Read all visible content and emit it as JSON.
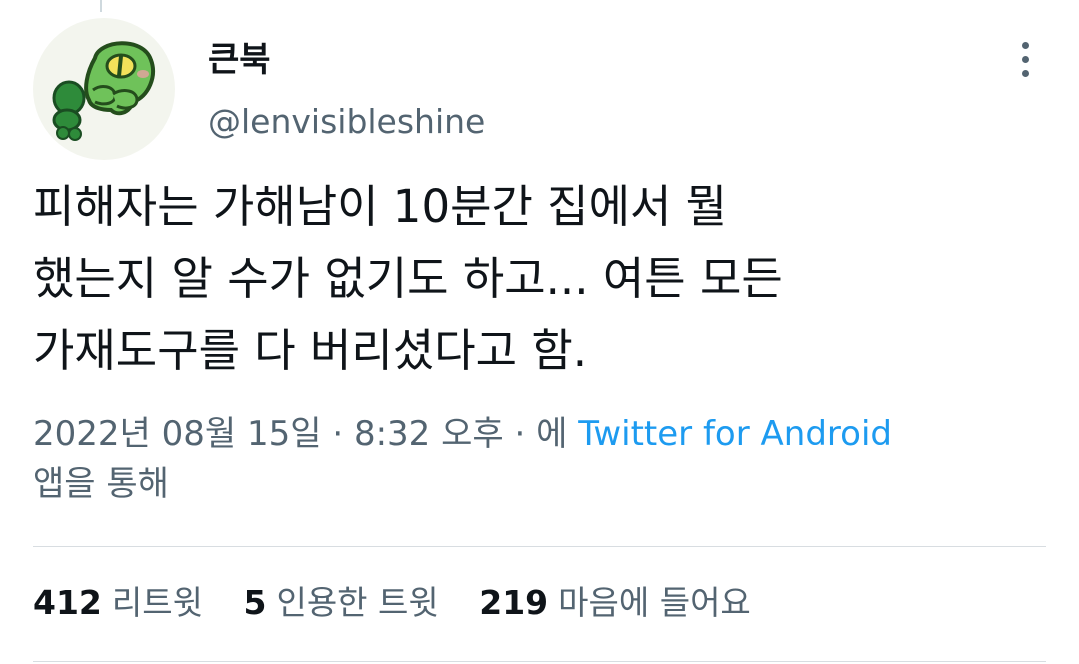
{
  "author": {
    "display_name": "큰북",
    "handle": "@lenvisibleshine",
    "avatar_icon": "green-monster-avatar"
  },
  "tweet": {
    "lines": [
      "피해자는 가해남이 10분간 집에서 뭘",
      "했는지 알 수가 없기도 하고... 여튼 모든",
      "가재도구를 다 버리셨다고 함."
    ],
    "date": "2022년 08월 15일",
    "time": "8:32 오후",
    "via_prefix": "에",
    "source": "Twitter for Android",
    "via_suffix": "앱을 통해"
  },
  "stats": {
    "retweets_count": "412",
    "retweets_label": "리트윗",
    "quotes_count": "5",
    "quotes_label": "인용한 트윗",
    "likes_count": "219",
    "likes_label": "마음에 들어요"
  },
  "colors": {
    "text": "#0f1419",
    "secondary": "#536471",
    "link": "#1d9bf0",
    "divider": "#d8dde1"
  }
}
